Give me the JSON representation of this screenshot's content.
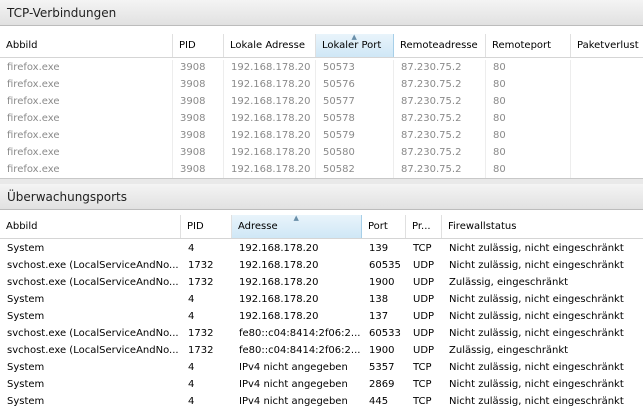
{
  "tcp": {
    "title": "TCP-Verbindungen",
    "headers": [
      "Abbild",
      "PID",
      "Lokale Adresse",
      "Lokaler Port",
      "Remoteadresse",
      "Remoteport",
      "Paketverlust"
    ],
    "sorted_column": "Lokaler Port",
    "rows": [
      [
        "firefox.exe",
        "3908",
        "192.168.178.20",
        "50573",
        "87.230.75.2",
        "80"
      ],
      [
        "firefox.exe",
        "3908",
        "192.168.178.20",
        "50576",
        "87.230.75.2",
        "80"
      ],
      [
        "firefox.exe",
        "3908",
        "192.168.178.20",
        "50577",
        "87.230.75.2",
        "80"
      ],
      [
        "firefox.exe",
        "3908",
        "192.168.178.20",
        "50578",
        "87.230.75.2",
        "80"
      ],
      [
        "firefox.exe",
        "3908",
        "192.168.178.20",
        "50579",
        "87.230.75.2",
        "80"
      ],
      [
        "firefox.exe",
        "3908",
        "192.168.178.20",
        "50580",
        "87.230.75.2",
        "80"
      ],
      [
        "firefox.exe",
        "3908",
        "192.168.178.20",
        "50582",
        "87.230.75.2",
        "80"
      ]
    ]
  },
  "ports": {
    "title": "Überwachungsports",
    "headers": [
      "Abbild",
      "PID",
      "Adresse",
      "Port",
      "Pr...",
      "Firewallstatus"
    ],
    "sorted_column": "Adresse",
    "rows": [
      [
        "System",
        "4",
        "192.168.178.20",
        "139",
        "TCP",
        "Nicht zulässig, nicht eingeschränkt"
      ],
      [
        "svchost.exe (LocalServiceAndNo...",
        "1732",
        "192.168.178.20",
        "60535",
        "UDP",
        "Nicht zulässig, nicht eingeschränkt"
      ],
      [
        "svchost.exe (LocalServiceAndNo...",
        "1732",
        "192.168.178.20",
        "1900",
        "UDP",
        "Zulässig, eingeschränkt"
      ],
      [
        "System",
        "4",
        "192.168.178.20",
        "138",
        "UDP",
        "Nicht zulässig, nicht eingeschränkt"
      ],
      [
        "System",
        "4",
        "192.168.178.20",
        "137",
        "UDP",
        "Nicht zulässig, nicht eingeschränkt"
      ],
      [
        "svchost.exe (LocalServiceAndNo...",
        "1732",
        "fe80::c04:8414:2f06:2...",
        "60533",
        "UDP",
        "Nicht zulässig, nicht eingeschränkt"
      ],
      [
        "svchost.exe (LocalServiceAndNo...",
        "1732",
        "fe80::c04:8414:2f06:2...",
        "1900",
        "UDP",
        "Zulässig, eingeschränkt"
      ],
      [
        "System",
        "4",
        "IPv4 nicht angegeben",
        "5357",
        "TCP",
        "Nicht zulässig, nicht eingeschränkt"
      ],
      [
        "System",
        "4",
        "IPv4 nicht angegeben",
        "2869",
        "TCP",
        "Nicht zulässig, nicht eingeschränkt"
      ],
      [
        "System",
        "4",
        "IPv4 nicht angegeben",
        "445",
        "TCP",
        "Nicht zulässig, nicht eingeschränkt"
      ]
    ]
  }
}
